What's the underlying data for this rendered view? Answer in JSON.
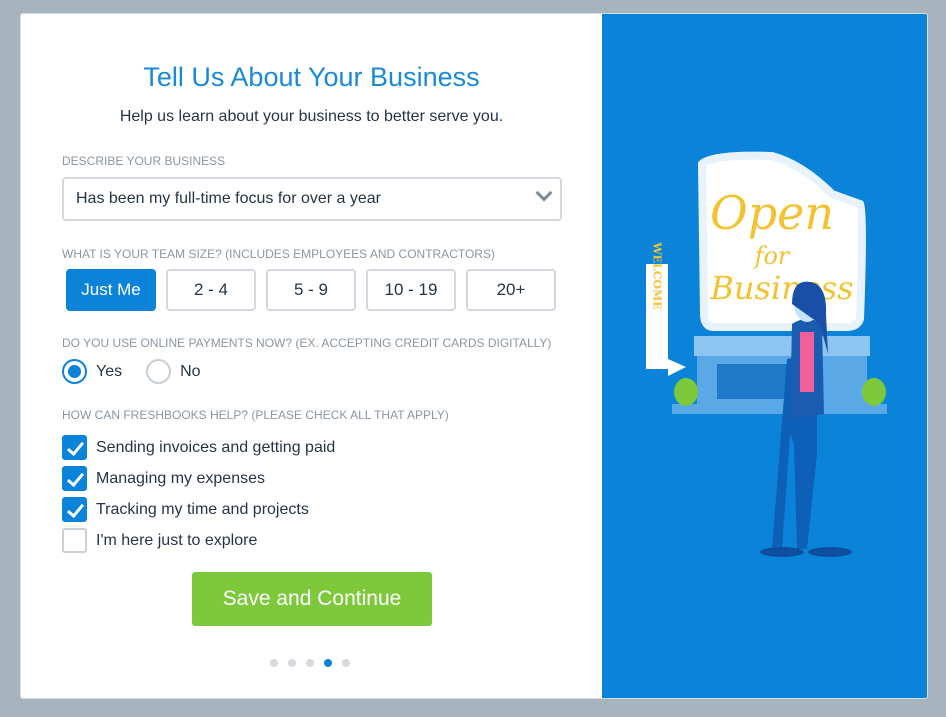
{
  "title": "Tell Us About Your Business",
  "subtitle": "Help us learn about your business to better serve you.",
  "describe": {
    "label": "Describe your business",
    "value": "Has been my full-time focus for over a year"
  },
  "team": {
    "label": "What is your team size? (includes employees and contractors)",
    "options": [
      "Just Me",
      "2 - 4",
      "5 - 9",
      "10 - 19",
      "20+"
    ],
    "selected": "Just Me"
  },
  "payments": {
    "label": "Do you use online payments now? (ex. accepting credit cards digitally)",
    "options": [
      "Yes",
      "No"
    ],
    "selected": "Yes"
  },
  "help": {
    "label": "How can FreshBooks help? (Please check all that apply)",
    "items": [
      {
        "label": "Sending invoices and getting paid",
        "checked": true
      },
      {
        "label": "Managing my expenses",
        "checked": true
      },
      {
        "label": "Tracking my time and projects",
        "checked": true
      },
      {
        "label": "I'm here just to explore",
        "checked": false
      }
    ]
  },
  "save_label": "Save and Continue",
  "pagination": {
    "total": 5,
    "current": 4
  },
  "illustration": {
    "sign": [
      "Open",
      "for",
      "Business"
    ],
    "welcome": "WELCOME"
  },
  "colors": {
    "accent": "#0a83d8",
    "save": "#7dc83b",
    "sign": "#f2c230"
  }
}
